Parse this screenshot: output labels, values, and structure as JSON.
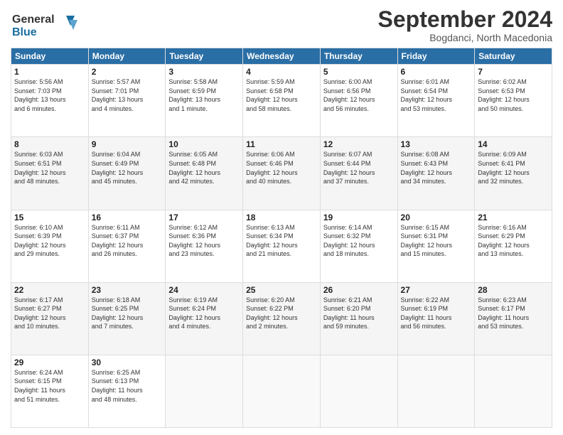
{
  "header": {
    "logo_line1": "General",
    "logo_line2": "Blue",
    "month": "September 2024",
    "location": "Bogdanci, North Macedonia"
  },
  "days_of_week": [
    "Sunday",
    "Monday",
    "Tuesday",
    "Wednesday",
    "Thursday",
    "Friday",
    "Saturday"
  ],
  "weeks": [
    [
      {
        "day": "1",
        "info": "Sunrise: 5:56 AM\nSunset: 7:03 PM\nDaylight: 13 hours\nand 6 minutes."
      },
      {
        "day": "2",
        "info": "Sunrise: 5:57 AM\nSunset: 7:01 PM\nDaylight: 13 hours\nand 4 minutes."
      },
      {
        "day": "3",
        "info": "Sunrise: 5:58 AM\nSunset: 6:59 PM\nDaylight: 13 hours\nand 1 minute."
      },
      {
        "day": "4",
        "info": "Sunrise: 5:59 AM\nSunset: 6:58 PM\nDaylight: 12 hours\nand 58 minutes."
      },
      {
        "day": "5",
        "info": "Sunrise: 6:00 AM\nSunset: 6:56 PM\nDaylight: 12 hours\nand 56 minutes."
      },
      {
        "day": "6",
        "info": "Sunrise: 6:01 AM\nSunset: 6:54 PM\nDaylight: 12 hours\nand 53 minutes."
      },
      {
        "day": "7",
        "info": "Sunrise: 6:02 AM\nSunset: 6:53 PM\nDaylight: 12 hours\nand 50 minutes."
      }
    ],
    [
      {
        "day": "8",
        "info": "Sunrise: 6:03 AM\nSunset: 6:51 PM\nDaylight: 12 hours\nand 48 minutes."
      },
      {
        "day": "9",
        "info": "Sunrise: 6:04 AM\nSunset: 6:49 PM\nDaylight: 12 hours\nand 45 minutes."
      },
      {
        "day": "10",
        "info": "Sunrise: 6:05 AM\nSunset: 6:48 PM\nDaylight: 12 hours\nand 42 minutes."
      },
      {
        "day": "11",
        "info": "Sunrise: 6:06 AM\nSunset: 6:46 PM\nDaylight: 12 hours\nand 40 minutes."
      },
      {
        "day": "12",
        "info": "Sunrise: 6:07 AM\nSunset: 6:44 PM\nDaylight: 12 hours\nand 37 minutes."
      },
      {
        "day": "13",
        "info": "Sunrise: 6:08 AM\nSunset: 6:43 PM\nDaylight: 12 hours\nand 34 minutes."
      },
      {
        "day": "14",
        "info": "Sunrise: 6:09 AM\nSunset: 6:41 PM\nDaylight: 12 hours\nand 32 minutes."
      }
    ],
    [
      {
        "day": "15",
        "info": "Sunrise: 6:10 AM\nSunset: 6:39 PM\nDaylight: 12 hours\nand 29 minutes."
      },
      {
        "day": "16",
        "info": "Sunrise: 6:11 AM\nSunset: 6:37 PM\nDaylight: 12 hours\nand 26 minutes."
      },
      {
        "day": "17",
        "info": "Sunrise: 6:12 AM\nSunset: 6:36 PM\nDaylight: 12 hours\nand 23 minutes."
      },
      {
        "day": "18",
        "info": "Sunrise: 6:13 AM\nSunset: 6:34 PM\nDaylight: 12 hours\nand 21 minutes."
      },
      {
        "day": "19",
        "info": "Sunrise: 6:14 AM\nSunset: 6:32 PM\nDaylight: 12 hours\nand 18 minutes."
      },
      {
        "day": "20",
        "info": "Sunrise: 6:15 AM\nSunset: 6:31 PM\nDaylight: 12 hours\nand 15 minutes."
      },
      {
        "day": "21",
        "info": "Sunrise: 6:16 AM\nSunset: 6:29 PM\nDaylight: 12 hours\nand 13 minutes."
      }
    ],
    [
      {
        "day": "22",
        "info": "Sunrise: 6:17 AM\nSunset: 6:27 PM\nDaylight: 12 hours\nand 10 minutes."
      },
      {
        "day": "23",
        "info": "Sunrise: 6:18 AM\nSunset: 6:25 PM\nDaylight: 12 hours\nand 7 minutes."
      },
      {
        "day": "24",
        "info": "Sunrise: 6:19 AM\nSunset: 6:24 PM\nDaylight: 12 hours\nand 4 minutes."
      },
      {
        "day": "25",
        "info": "Sunrise: 6:20 AM\nSunset: 6:22 PM\nDaylight: 12 hours\nand 2 minutes."
      },
      {
        "day": "26",
        "info": "Sunrise: 6:21 AM\nSunset: 6:20 PM\nDaylight: 11 hours\nand 59 minutes."
      },
      {
        "day": "27",
        "info": "Sunrise: 6:22 AM\nSunset: 6:19 PM\nDaylight: 11 hours\nand 56 minutes."
      },
      {
        "day": "28",
        "info": "Sunrise: 6:23 AM\nSunset: 6:17 PM\nDaylight: 11 hours\nand 53 minutes."
      }
    ],
    [
      {
        "day": "29",
        "info": "Sunrise: 6:24 AM\nSunset: 6:15 PM\nDaylight: 11 hours\nand 51 minutes."
      },
      {
        "day": "30",
        "info": "Sunrise: 6:25 AM\nSunset: 6:13 PM\nDaylight: 11 hours\nand 48 minutes."
      },
      {
        "day": "",
        "info": ""
      },
      {
        "day": "",
        "info": ""
      },
      {
        "day": "",
        "info": ""
      },
      {
        "day": "",
        "info": ""
      },
      {
        "day": "",
        "info": ""
      }
    ]
  ]
}
